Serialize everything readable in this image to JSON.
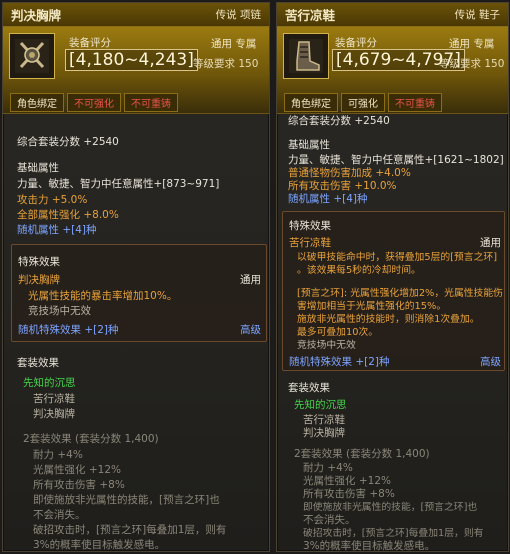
{
  "left": {
    "title": "判决胸牌",
    "title_tag": "传说 项链",
    "score_label": "装备评分",
    "score_value": "[4,180~4,243]",
    "usage": "通用 专属",
    "level_req": "等级要求 150",
    "tags": [
      "角色绑定",
      "不可强化",
      "不可重铸"
    ],
    "set_points": "综合套装分数 +2540",
    "base_header": "基础属性",
    "base_stats": [
      "力量、敏捷、智力中任意属性+[873~971]"
    ],
    "orange_stats": [
      "攻击力 +5.0%",
      "全部属性强化 +8.0%"
    ],
    "random_attr": "随机属性 +[4]种",
    "special_header": "特殊效果",
    "special_name": "判决胸牌",
    "special_usage": "通用",
    "special_lines": [
      "光属性技能的暴击率增加10%。",
      "竞技场中无效"
    ],
    "random_special": "随机特殊效果 +[2]种",
    "grade": "高级",
    "set_header": "套装效果",
    "set_name": "先知的沉思",
    "set_items": [
      "苦行凉鞋",
      "判决胸牌"
    ],
    "set_bonus_header": "2套装效果 (套装分数 1,400)",
    "set_bonus_lines": [
      "耐力 +4%",
      "光属性强化 +12%",
      "所有攻击伤害 +8%",
      "即使施放非光属性的技能，[预言之环]也",
      "不会消失。",
      "破招攻击时，[预言之环]每叠加1层，则有",
      "3%的概率使目标触发感电。"
    ]
  },
  "right": {
    "title": "苦行凉鞋",
    "title_tag": "传说 鞋子",
    "score_label": "装备评分",
    "score_value": "[4,679~4,797]",
    "usage": "通用 专属",
    "level_req": "等级要求 150",
    "tags": [
      "角色绑定",
      "可强化",
      "不可重铸"
    ],
    "set_points": "综合套装分数 +2540",
    "base_header": "基础属性",
    "base_stats": [
      "力量、敏捷、智力中任意属性+[1621~1802]"
    ],
    "orange_stats": [
      "普通怪物伤害加成 +4.0%",
      "所有攻击伤害 +10.0%"
    ],
    "random_attr": "随机属性 +[4]种",
    "special_header": "特殊效果",
    "special_name": "苦行凉鞋",
    "special_usage": "通用",
    "special_lines_a": [
      "以破甲技能命中时，获得叠加5层的[预言之环]",
      "。该效果每5秒的冷却时间。"
    ],
    "special_lines_b": [
      "[预言之环]: 光属性强化增加2%，光属性技能伤",
      "害增加相当于光属性强化的15%。",
      "施放非光属性的技能时，则消除1次叠加。",
      "最多可叠加10次。",
      "竞技场中无效"
    ],
    "random_special": "随机特殊效果 +[2]种",
    "grade": "高级",
    "set_header": "套装效果",
    "set_name": "先知的沉思",
    "set_items": [
      "苦行凉鞋",
      "判决胸牌"
    ],
    "set_bonus_header": "2套装效果 (套装分数 1,400)",
    "set_bonus_lines": [
      "耐力 +4%",
      "光属性强化 +12%",
      "所有攻击伤害 +8%",
      "即使施放非光属性的技能，[预言之环]也",
      "不会消失。",
      "破招攻击时，[预言之环]每叠加1层，则有",
      "3%的概率使目标触发感电。"
    ]
  }
}
